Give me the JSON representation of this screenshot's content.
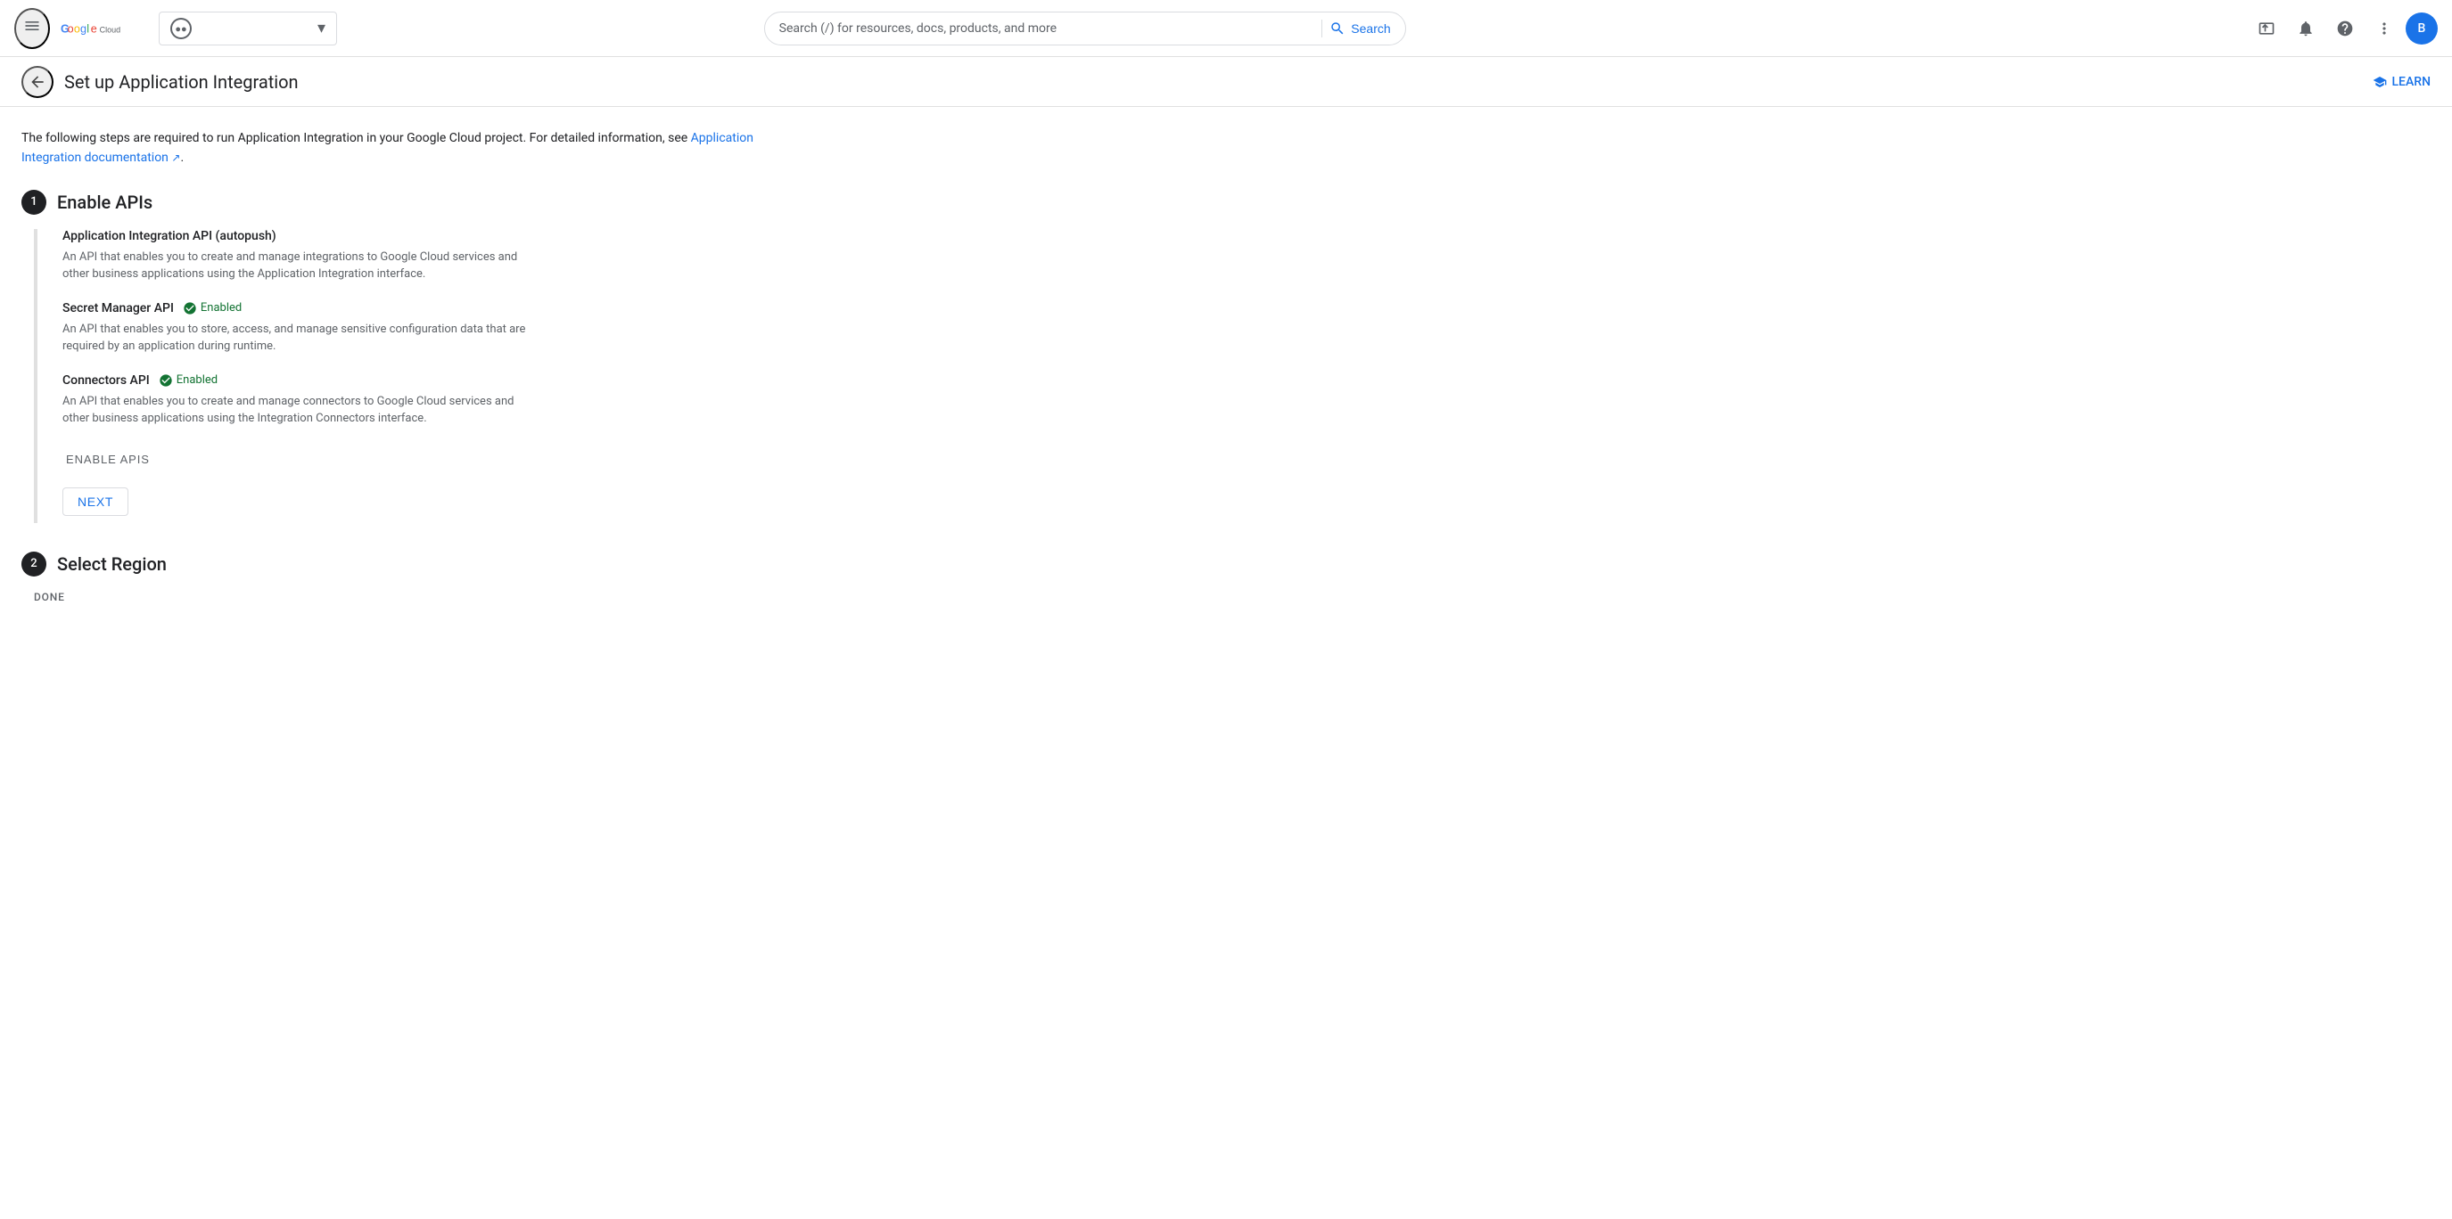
{
  "topnav": {
    "logo": {
      "g": "G",
      "o1": "o",
      "o2": "o",
      "g2": "g",
      "l": "l",
      "e": "e",
      "cloud": "Cloud"
    },
    "project": {
      "name": "",
      "dropdown_label": "Project selector"
    },
    "search": {
      "placeholder": "Search (/) for resources, docs, products, and more",
      "button_label": "Search"
    },
    "user_initial": "B"
  },
  "subheader": {
    "title": "Set up Application Integration",
    "learn_label": "LEARN"
  },
  "intro": {
    "text_before": "The following steps are required to run Application Integration in your Google Cloud project. For detailed information, see ",
    "link_text": "Application Integration documentation",
    "text_after": "."
  },
  "steps": [
    {
      "number": "1",
      "title": "Enable APIs",
      "apis": [
        {
          "name": "Application Integration API (autopush)",
          "enabled": false,
          "enabled_label": "",
          "description": "An API that enables you to create and manage integrations to Google Cloud services and other business applications using the Application Integration interface."
        },
        {
          "name": "Secret Manager API",
          "enabled": true,
          "enabled_label": "Enabled",
          "description": "An API that enables you to store, access, and manage sensitive configuration data that are required by an application during runtime."
        },
        {
          "name": "Connectors API",
          "enabled": true,
          "enabled_label": "Enabled",
          "description": "An API that enables you to create and manage connectors to Google Cloud services and other business applications using the Integration Connectors interface."
        }
      ],
      "buttons": [
        {
          "label": "ENABLE APIS",
          "type": "text"
        },
        {
          "label": "NEXT",
          "type": "outlined"
        }
      ]
    },
    {
      "number": "2",
      "title": "Select Region"
    }
  ],
  "done_label": "DONE"
}
